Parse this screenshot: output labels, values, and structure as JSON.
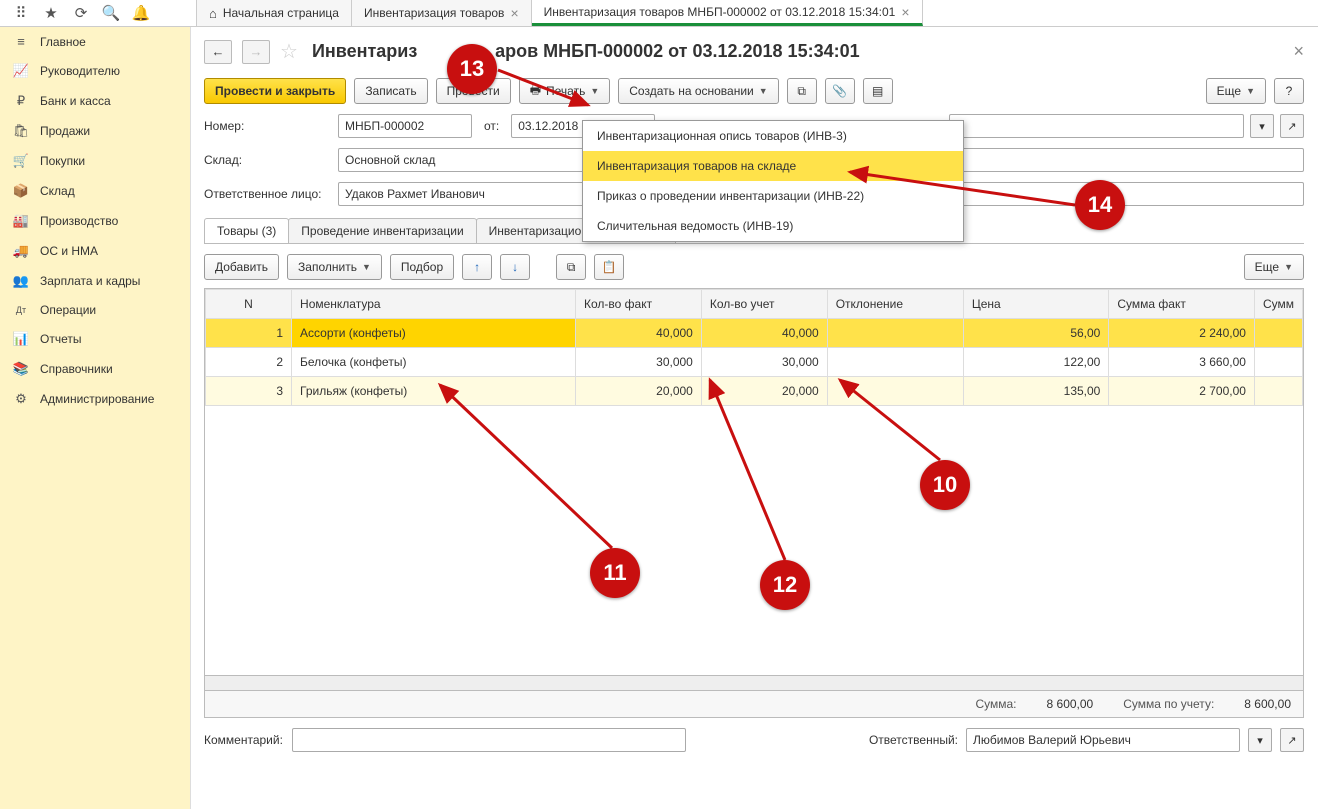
{
  "topIcons": [
    "⠿",
    "★",
    "⟳",
    "🔍",
    "🔔"
  ],
  "tabs": [
    {
      "label": "Начальная страница",
      "home": true,
      "closable": false
    },
    {
      "label": "Инвентаризация товаров",
      "closable": true
    },
    {
      "label": "Инвентаризация товаров МНБП-000002 от 03.12.2018 15:34:01",
      "closable": true,
      "active": true
    }
  ],
  "sidebar": [
    {
      "ico": "≡",
      "label": "Главное"
    },
    {
      "ico": "📈",
      "label": "Руководителю"
    },
    {
      "ico": "₽",
      "label": "Банк и касса"
    },
    {
      "ico": "🛍",
      "label": "Продажи"
    },
    {
      "ico": "🛒",
      "label": "Покупки"
    },
    {
      "ico": "📦",
      "label": "Склад"
    },
    {
      "ico": "🏭",
      "label": "Производство"
    },
    {
      "ico": "🚚",
      "label": "ОС и НМА"
    },
    {
      "ico": "👥",
      "label": "Зарплата и кадры"
    },
    {
      "ico": "Дт",
      "label": "Операции"
    },
    {
      "ico": "📊",
      "label": "Отчеты"
    },
    {
      "ico": "📚",
      "label": "Справочники"
    },
    {
      "ico": "⚙",
      "label": "Администрирование"
    }
  ],
  "pageTitle": "Инвентаризация товаров МНБП-000002 от 03.12.2018 15:34:01",
  "titlePart1": "Инвентариз",
  "titlePart2": "аров МНБП-000002 от 03.12.2018 15:34:01",
  "toolbar": {
    "postClose": "Провести и закрыть",
    "write": "Записать",
    "post": "Провести",
    "print": "Печать",
    "createBased": "Создать на основании",
    "more": "Еще"
  },
  "form": {
    "numberLabel": "Номер:",
    "numberValue": "МНБП-000002",
    "fromLabel": "от:",
    "dateValue": "03.12.2018 15:34:01",
    "warehouseLabel": "Склад:",
    "warehouseValue": "Основной склад",
    "respLabel": "Ответственное лицо:",
    "respValue": "Удаков Рахмет Иванович"
  },
  "subtabs": [
    "Товары (3)",
    "Проведение инвентаризации",
    "Инвентаризационная комиссия"
  ],
  "tableToolbar": {
    "add": "Добавить",
    "fill": "Заполнить",
    "pick": "Подбор",
    "more": "Еще"
  },
  "columns": [
    "N",
    "Номенклатура",
    "Кол-во факт",
    "Кол-во учет",
    "Отклонение",
    "Цена",
    "Сумма факт",
    "Сумм"
  ],
  "rows": [
    {
      "n": "1",
      "name": "Ассорти (конфеты)",
      "fact": "40,000",
      "acct": "40,000",
      "dev": "",
      "price": "56,00",
      "sumFact": "2 240,00",
      "sel": true
    },
    {
      "n": "2",
      "name": "Белочка (конфеты)",
      "fact": "30,000",
      "acct": "30,000",
      "dev": "",
      "price": "122,00",
      "sumFact": "3 660,00"
    },
    {
      "n": "3",
      "name": "Грильяж (конфеты)",
      "fact": "20,000",
      "acct": "20,000",
      "dev": "",
      "price": "135,00",
      "sumFact": "2 700,00"
    }
  ],
  "totals": {
    "sumLabel": "Сумма:",
    "sumValue": "8 600,00",
    "sumAcctLabel": "Сумма по учету:",
    "sumAcctValue": "8 600,00"
  },
  "footer": {
    "commentLabel": "Комментарий:",
    "commentValue": "",
    "respLabel": "Ответственный:",
    "respValue": "Любимов Валерий Юрьевич"
  },
  "printMenu": [
    "Инвентаризационная опись товаров (ИНВ-3)",
    "Инвентаризация товаров на складе",
    "Приказ о проведении инвентаризации (ИНВ-22)",
    "Сличительная ведомость (ИНВ-19)"
  ],
  "annotations": {
    "b10": "10",
    "b11": "11",
    "b12": "12",
    "b13": "13",
    "b14": "14"
  }
}
